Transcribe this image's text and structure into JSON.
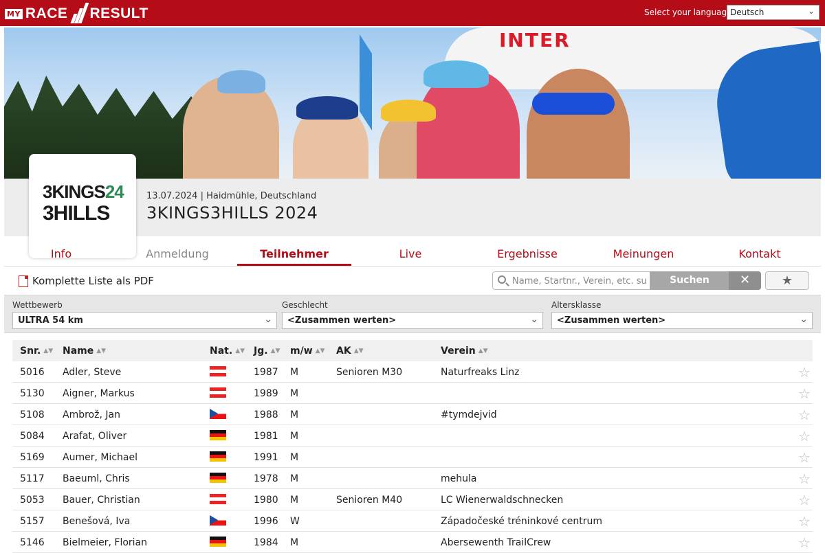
{
  "header": {
    "logo_my": "MY",
    "logo_race": "RACE",
    "logo_result": "RESULT",
    "language_label": "Select your language:",
    "language_value": "Deutsch"
  },
  "banner": {
    "arch_text": "INTER"
  },
  "event": {
    "logo_line1_a": "3KINGS",
    "logo_line1_b": "24",
    "logo_line2": "3HILLS",
    "meta": "13.07.2024 | Haidmühle, Deutschland",
    "title": "3KINGS3HILLS 2024"
  },
  "nav": {
    "tabs": [
      {
        "label": "Info"
      },
      {
        "label": "Anmeldung"
      },
      {
        "label": "Teilnehmer"
      },
      {
        "label": "Live"
      },
      {
        "label": "Ergebnisse"
      },
      {
        "label": "Meinungen"
      },
      {
        "label": "Kontakt"
      }
    ]
  },
  "toolbar": {
    "pdf_label": "Komplette Liste als PDF",
    "search_placeholder": "Name, Startnr., Verein, etc. su",
    "search_button": "Suchen",
    "clear_button": "✕",
    "favorite_button": "★"
  },
  "filters": {
    "competition_label": "Wettbewerb",
    "competition_value": "ULTRA 54 km",
    "gender_label": "Geschlecht",
    "gender_value": "<Zusammen werten>",
    "age_label": "Altersklasse",
    "age_value": "<Zusammen werten>"
  },
  "table": {
    "columns": {
      "snr": "Snr.",
      "name": "Name",
      "nat": "Nat.",
      "jg": "Jg.",
      "mw": "m/w",
      "ak": "AK",
      "verein": "Verein"
    },
    "rows": [
      {
        "snr": "5016",
        "name": "Adler, Steve",
        "nat": "at",
        "jg": "1987",
        "mw": "M",
        "ak": "Senioren M30",
        "verein": "Naturfreaks Linz"
      },
      {
        "snr": "5130",
        "name": "Aigner, Markus",
        "nat": "at",
        "jg": "1989",
        "mw": "M",
        "ak": "",
        "verein": ""
      },
      {
        "snr": "5108",
        "name": "Ambrož, Jan",
        "nat": "cz",
        "jg": "1988",
        "mw": "M",
        "ak": "",
        "verein": "#tymdejvid"
      },
      {
        "snr": "5084",
        "name": "Arafat, Oliver",
        "nat": "de",
        "jg": "1981",
        "mw": "M",
        "ak": "",
        "verein": ""
      },
      {
        "snr": "5169",
        "name": "Aumer, Michael",
        "nat": "de",
        "jg": "1991",
        "mw": "M",
        "ak": "",
        "verein": ""
      },
      {
        "snr": "5117",
        "name": "Baeuml, Chris",
        "nat": "de",
        "jg": "1978",
        "mw": "M",
        "ak": "",
        "verein": "mehula"
      },
      {
        "snr": "5053",
        "name": "Bauer, Christian",
        "nat": "at",
        "jg": "1980",
        "mw": "M",
        "ak": "Senioren M40",
        "verein": "LC Wienerwaldschnecken"
      },
      {
        "snr": "5157",
        "name": "Benešová, Iva",
        "nat": "cz",
        "jg": "1996",
        "mw": "W",
        "ak": "",
        "verein": "Západočeské tréninkové centrum"
      },
      {
        "snr": "5146",
        "name": "Bielmeier, Florian",
        "nat": "de",
        "jg": "1984",
        "mw": "M",
        "ak": "",
        "verein": "Abersewenth TrailCrew"
      }
    ]
  },
  "colors": {
    "brand": "#b50d18",
    "row_divider": "#e2e2e2"
  }
}
